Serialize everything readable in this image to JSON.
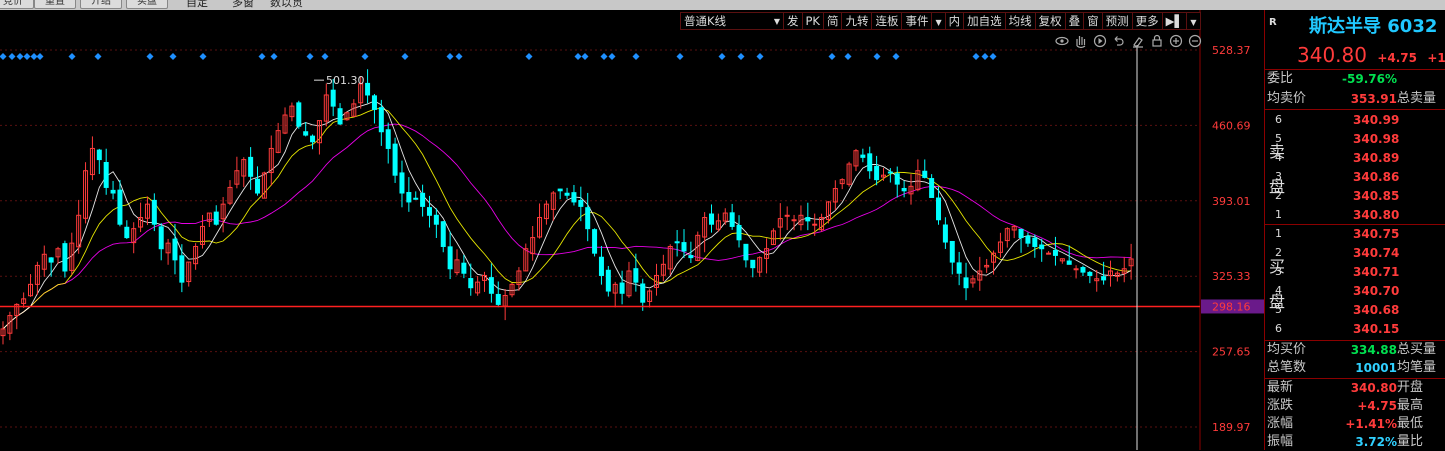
{
  "top_tabs": [
    "竞价",
    "重置",
    "介绍",
    "实盘",
    "自定",
    "多窗",
    "数以贯"
  ],
  "toolbar": {
    "kline_type": "普通K线",
    "buttons": [
      "发",
      "PK",
      "简",
      "九转",
      "连板",
      "事件",
      "内",
      "加自选",
      "均线",
      "复权",
      "叠",
      "窗",
      "预测",
      "更多"
    ]
  },
  "chart_icons": [
    "eye-icon",
    "pan-icon",
    "play-icon",
    "undo-icon",
    "erase-icon",
    "lock-icon",
    "zoom-in-icon",
    "zoom-out-icon"
  ],
  "chart_data": {
    "type": "candlestick",
    "price_axis_labels": [
      "528.37",
      "460.69",
      "393.01",
      "325.33",
      "257.65",
      "189.97"
    ],
    "ylim": [
      189.97,
      528.37
    ],
    "current_line_label": "298.16",
    "max_annotation": "501.30",
    "close_series": [
      278,
      290,
      300,
      305,
      318,
      335,
      345,
      338,
      350,
      330,
      355,
      380,
      420,
      440,
      430,
      405,
      400,
      372,
      360,
      368,
      378,
      390,
      372,
      350,
      355,
      340,
      320,
      338,
      352,
      370,
      382,
      372,
      390,
      405,
      420,
      430,
      415,
      400,
      418,
      440,
      456,
      470,
      478,
      460,
      452,
      446,
      465,
      488,
      478,
      462,
      472,
      480,
      498,
      488,
      475,
      455,
      440,
      416,
      400,
      392,
      395,
      388,
      380,
      372,
      352,
      332,
      340,
      328,
      315,
      320,
      326,
      310,
      300,
      308,
      318,
      330,
      350,
      360,
      378,
      390,
      400,
      402,
      398,
      392,
      388,
      368,
      346,
      326,
      312,
      318,
      310,
      330,
      320,
      302,
      312,
      326,
      336,
      352,
      356,
      348,
      342,
      362,
      378,
      372,
      375,
      382,
      370,
      358,
      340,
      333,
      342,
      350,
      366,
      377,
      380,
      376,
      380,
      375,
      372,
      378,
      392,
      404,
      412,
      426,
      438,
      432,
      420,
      412,
      416,
      418,
      408,
      402,
      406,
      420,
      414,
      396,
      376,
      356,
      338,
      328,
      315,
      323,
      330,
      335,
      346,
      356,
      368,
      370,
      360,
      355,
      352,
      350,
      346,
      344,
      341,
      336,
      332,
      329,
      326,
      323,
      322,
      330,
      328,
      332,
      340.8
    ]
  },
  "stock": {
    "name": "斯达半导",
    "code": "6032",
    "price": "340.80",
    "change": "+4.75",
    "change_pct_trunc": "+1"
  },
  "panel": {
    "wei_bi_label": "委比",
    "wei_bi_value": "-59.76%",
    "avg_ask_label": "均卖价",
    "avg_ask_value": "353.91",
    "total_sell_label": "总卖量",
    "sell_side_label_1": "卖",
    "sell_side_label_2": "盘",
    "asks": [
      {
        "idx": "6",
        "price": "340.99"
      },
      {
        "idx": "5",
        "price": "340.98"
      },
      {
        "idx": "4",
        "price": "340.89"
      },
      {
        "idx": "3",
        "price": "340.86"
      },
      {
        "idx": "2",
        "price": "340.85"
      },
      {
        "idx": "1",
        "price": "340.80"
      }
    ],
    "buy_side_label_1": "买",
    "buy_side_label_2": "盘",
    "bids": [
      {
        "idx": "1",
        "price": "340.75"
      },
      {
        "idx": "2",
        "price": "340.74"
      },
      {
        "idx": "3",
        "price": "340.71"
      },
      {
        "idx": "4",
        "price": "340.70"
      },
      {
        "idx": "5",
        "price": "340.68"
      },
      {
        "idx": "6",
        "price": "340.15"
      }
    ],
    "avg_bid_label": "均买价",
    "avg_bid_value": "334.88",
    "total_buy_label": "总买量",
    "total_trades_label": "总笔数",
    "total_trades_value": "10001",
    "avg_trade_label": "均笔量",
    "latest_label": "最新",
    "latest_value": "340.80",
    "open_label": "开盘",
    "change_label": "涨跌",
    "change_value": "+4.75",
    "high_label": "最高",
    "pct_label": "涨幅",
    "pct_value": "+1.41%",
    "low_label": "最低",
    "amp_label": "振幅",
    "amp_value": "3.72%",
    "vol_ratio_label": "量比",
    "r_badge": "R"
  },
  "colors": {
    "up": "#ff3b3b",
    "down": "#00ffff",
    "ma5": "#ffffff",
    "ma10": "#ffff00",
    "ma20": "#ff00ff",
    "price_line": "#ff2020",
    "axis_text": "#ff3b3b",
    "marker": "#1e90ff"
  }
}
